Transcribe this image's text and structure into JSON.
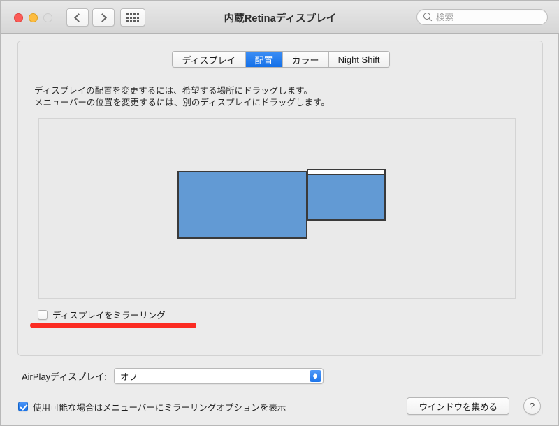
{
  "window": {
    "title": "内蔵Retinaディスプレイ",
    "traffic_lights": [
      "close",
      "minimize",
      "zoom"
    ],
    "back_label": "戻る",
    "forward_label": "進む",
    "showall_label": "すべてを表示"
  },
  "search": {
    "placeholder": "検索",
    "value": ""
  },
  "tabs": [
    {
      "label": "ディスプレイ",
      "selected": false
    },
    {
      "label": "配置",
      "selected": true
    },
    {
      "label": "カラー",
      "selected": false
    },
    {
      "label": "Night Shift",
      "selected": false
    }
  ],
  "instructions": {
    "line1": "ディスプレイの配置を変更するには、希望する場所にドラッグします。",
    "line2": "メニューバーの位置を変更するには、別のディスプレイにドラッグします。"
  },
  "arrangement": {
    "displays": [
      {
        "name": "primary-display",
        "has_menubar": false
      },
      {
        "name": "secondary-display",
        "has_menubar": true
      }
    ]
  },
  "mirror": {
    "label": "ディスプレイをミラーリング",
    "checked": false
  },
  "annotation": {
    "present": true,
    "color": "#fb2b22"
  },
  "airplay": {
    "label": "AirPlayディスプレイ:",
    "value": "オフ"
  },
  "menubar_option": {
    "label": "使用可能な場合はメニューバーにミラーリングオプションを表示",
    "checked": true
  },
  "buttons": {
    "gather_windows": "ウインドウを集める",
    "help": "?"
  },
  "colors": {
    "display_fill": "#629ad4",
    "display_border": "#3a3a3a",
    "tab_selected": "#1470e8",
    "annotation": "#fb2b22",
    "window_bg": "#ececec"
  }
}
